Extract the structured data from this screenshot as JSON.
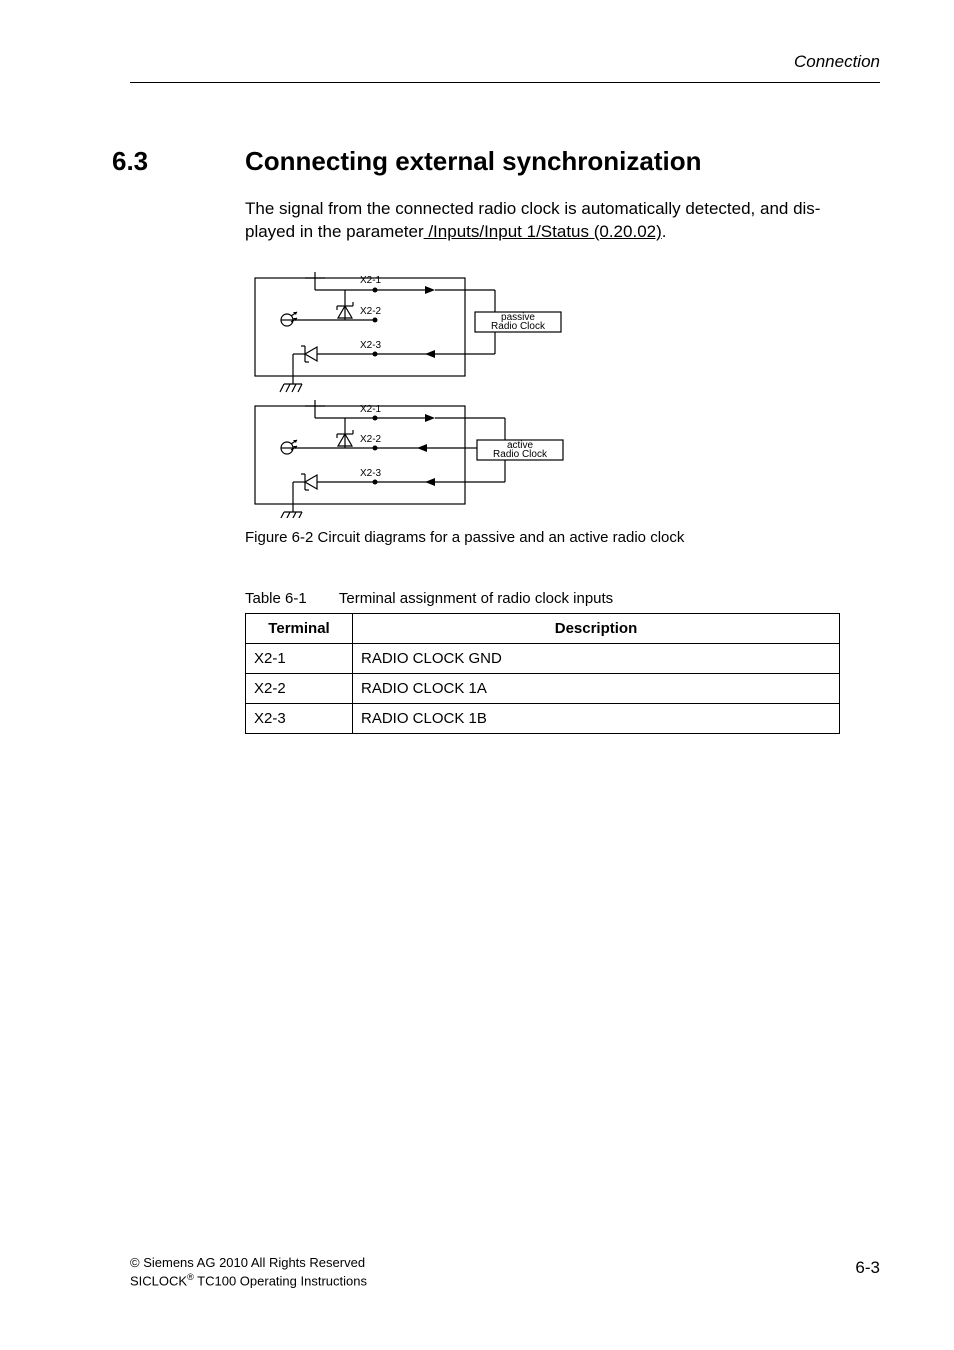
{
  "header": {
    "section_label": "Connection"
  },
  "section": {
    "number": "6.3",
    "title": "Connecting external synchronization"
  },
  "body": {
    "intro_1": "The signal from the connected radio clock is automatically detected, and dis-",
    "intro_2": "played in the parameter",
    "param_link": " /Inputs/Input 1/Status (0.20.02)",
    "period": "."
  },
  "figure": {
    "caption": "Figure 6-2 Circuit diagrams for a passive and an active radio clock",
    "terminals": {
      "x21": "X2-1",
      "x22": "X2-2",
      "x23": "X2-3"
    },
    "labels": {
      "passive": "passive\nRadio Clock",
      "active": "active\nRadio Clock"
    }
  },
  "table": {
    "caption_prefix": "Table 6-1",
    "caption_title": "Terminal assignment of radio clock inputs",
    "headers": {
      "terminal": "Terminal",
      "description": "Description"
    },
    "rows": [
      {
        "terminal": "X2-1",
        "description": "RADIO CLOCK GND"
      },
      {
        "terminal": "X2-2",
        "description": "RADIO CLOCK 1A"
      },
      {
        "terminal": "X2-3",
        "description": "RADIO CLOCK 1B"
      }
    ]
  },
  "footer": {
    "left_line1_prefix": "©",
    "left_line1": " Siemens AG 2010 All Rights Reserved",
    "left_line2_a": "SICLOCK",
    "left_line2_sup": "®",
    "left_line2_b": " TC100 Operating Instructions",
    "page": "6-3"
  }
}
